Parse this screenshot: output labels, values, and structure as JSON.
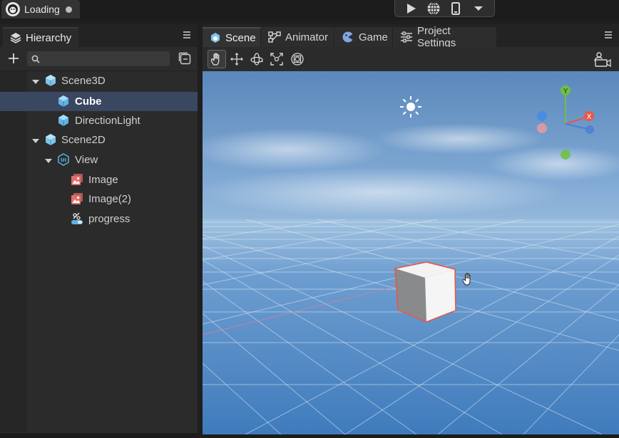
{
  "app": {
    "title": "Loading",
    "logo_icon": "monkey-logo-icon"
  },
  "playbar": {
    "buttons": [
      "play-icon",
      "globe-icon",
      "phone-icon",
      "chevron-down-icon"
    ]
  },
  "hierarchy": {
    "tab_label": "Hierarchy",
    "search_placeholder": "",
    "items": [
      {
        "label": "Scene3D",
        "type": "scene3d",
        "expanded": true,
        "depth": 0
      },
      {
        "label": "Cube",
        "type": "sprite3d",
        "selected": true,
        "depth": 1
      },
      {
        "label": "DirectionLight",
        "type": "sprite3d",
        "depth": 1
      },
      {
        "label": "Scene2D",
        "type": "scene3d",
        "expanded": true,
        "depth": 0
      },
      {
        "label": "View",
        "type": "ui",
        "expanded": true,
        "depth": 1
      },
      {
        "label": "Image",
        "type": "image",
        "depth": 2
      },
      {
        "label": "Image(2)",
        "type": "image",
        "depth": 2
      },
      {
        "label": "progress",
        "type": "progress",
        "depth": 2
      }
    ]
  },
  "editor_tabs": [
    {
      "label": "Scene",
      "icon": "scene-icon",
      "active": true
    },
    {
      "label": "Animator",
      "icon": "animator-icon"
    },
    {
      "label": "Game",
      "icon": "game-icon"
    },
    {
      "label": "Project Settings",
      "icon": "settings-sliders-icon"
    }
  ],
  "scene_tools": [
    "hand-tool-icon",
    "move-tool-icon",
    "rotate-tool-icon",
    "scale-tool-icon",
    "rect-tool-icon"
  ],
  "gizmo": {
    "y": "Y",
    "x": "X"
  },
  "colors": {
    "selection": "#3a4760",
    "accent_blue": "#5fb3e6",
    "selection_outline": "#e8574a",
    "image_icon": "#e0706a"
  }
}
